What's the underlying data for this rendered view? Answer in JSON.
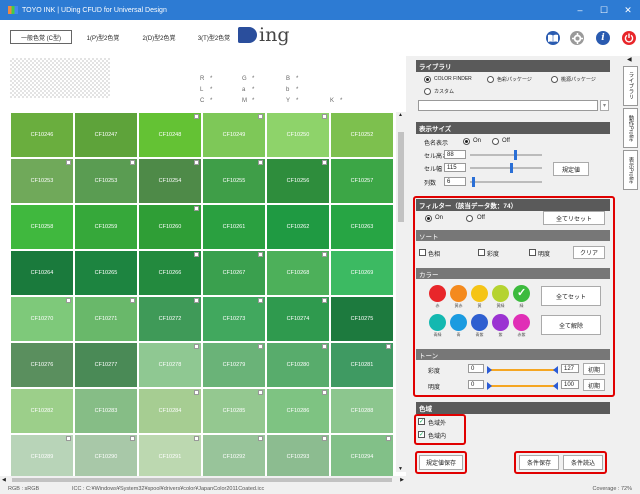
{
  "window": {
    "title": "TOYO INK | UDing CFUD for Universal Design",
    "minimize": "–",
    "maximize": "☐",
    "close": "✕"
  },
  "toolbar": {
    "tabs": [
      "一般色覚 (C型)",
      "1(P)型2色覚",
      "2(D)型2色覚",
      "3(T)型2色覚"
    ],
    "logo_text": "ing",
    "icons": [
      "book-icon",
      "gear-icon",
      "info-icon",
      "power-icon"
    ],
    "info_glyph": "i"
  },
  "swatch_labels": {
    "r": "R",
    "g": "G",
    "b": "B",
    "l": "L",
    "a": "a",
    "b2": "b",
    "c": "C",
    "m": "M",
    "y": "Y",
    "k": "K",
    "sep": "*"
  },
  "grid": {
    "cells": [
      {
        "code": "CF10246",
        "color": "#6aae3e",
        "marked": false
      },
      {
        "code": "CF10247",
        "color": "#5ea33a",
        "marked": false
      },
      {
        "code": "CF10248",
        "color": "#64c234",
        "marked": true
      },
      {
        "code": "CF10249",
        "color": "#7ec858",
        "marked": true
      },
      {
        "code": "CF10250",
        "color": "#8ed36a",
        "marked": true
      },
      {
        "code": "CF10252",
        "color": "#7dc04e",
        "marked": false
      },
      {
        "code": "CF10253",
        "color": "#70a95a",
        "marked": true
      },
      {
        "code": "CF10253",
        "color": "#5a9c52",
        "marked": true
      },
      {
        "code": "CF10254",
        "color": "#4e8a48",
        "marked": true
      },
      {
        "code": "CF10255",
        "color": "#3f9e48",
        "marked": true
      },
      {
        "code": "CF10256",
        "color": "#2e8d3c",
        "marked": true
      },
      {
        "code": "CF10257",
        "color": "#3ca646",
        "marked": false
      },
      {
        "code": "CF10258",
        "color": "#40b83e",
        "marked": false
      },
      {
        "code": "CF10259",
        "color": "#36a83a",
        "marked": false
      },
      {
        "code": "CF10260",
        "color": "#2f9e36",
        "marked": true
      },
      {
        "code": "CF10261",
        "color": "#2aa040",
        "marked": false
      },
      {
        "code": "CF10262",
        "color": "#1f9a42",
        "marked": false
      },
      {
        "code": "CF10263",
        "color": "#27a544",
        "marked": false
      },
      {
        "code": "CF10264",
        "color": "#1a7a3c",
        "marked": false
      },
      {
        "code": "CF10265",
        "color": "#1d8440",
        "marked": false
      },
      {
        "code": "CF10266",
        "color": "#238a3e",
        "marked": true
      },
      {
        "code": "CF10267",
        "color": "#3aa04e",
        "marked": true
      },
      {
        "code": "CF10268",
        "color": "#4db05a",
        "marked": true
      },
      {
        "code": "CF10269",
        "color": "#3cba62",
        "marked": false
      },
      {
        "code": "CF10270",
        "color": "#7ec97a",
        "marked": true
      },
      {
        "code": "CF10271",
        "color": "#69b86a",
        "marked": true
      },
      {
        "code": "CF10272",
        "color": "#3f9a58",
        "marked": true
      },
      {
        "code": "CF10273",
        "color": "#41a85e",
        "marked": true
      },
      {
        "code": "CF10274",
        "color": "#2f9a4e",
        "marked": true
      },
      {
        "code": "CF10275",
        "color": "#1d7a3e",
        "marked": false
      },
      {
        "code": "CF10276",
        "color": "#5a8f5e",
        "marked": false
      },
      {
        "code": "CF10277",
        "color": "#4a8a56",
        "marked": false
      },
      {
        "code": "CF10278",
        "color": "#8fc892",
        "marked": true
      },
      {
        "code": "CF10279",
        "color": "#6ab378",
        "marked": true
      },
      {
        "code": "CF10280",
        "color": "#58ac6c",
        "marked": true
      },
      {
        "code": "CF10281",
        "color": "#3f9a62",
        "marked": true
      },
      {
        "code": "CF10282",
        "color": "#9ccf8a",
        "marked": false
      },
      {
        "code": "CF10283",
        "color": "#86bd86",
        "marked": false
      },
      {
        "code": "CF10284",
        "color": "#a6cd92",
        "marked": true
      },
      {
        "code": "CF10285",
        "color": "#94c890",
        "marked": true
      },
      {
        "code": "CF10286",
        "color": "#7ec382",
        "marked": true
      },
      {
        "code": "CF10288",
        "color": "#8cc68e",
        "marked": false
      },
      {
        "code": "CF10289",
        "color": "#b8d4b8",
        "marked": true
      },
      {
        "code": "CF10290",
        "color": "#a8c8a8",
        "marked": true
      },
      {
        "code": "CF10291",
        "color": "#bcd8b0",
        "marked": true
      },
      {
        "code": "CF10292",
        "color": "#98c49a",
        "marked": true
      },
      {
        "code": "CF10293",
        "color": "#8cbc90",
        "marked": true
      },
      {
        "code": "CF10294",
        "color": "#82c088",
        "marked": true
      }
    ]
  },
  "panel": {
    "library": {
      "title": "ライブラリ",
      "opt1": "COLOR FINDER",
      "opt2": "色彩パッケージ",
      "opt3": "桃源パッケージ",
      "opt4": "カスタム"
    },
    "display": {
      "title": "表示サイズ",
      "name_label": "色名表示",
      "on": "On",
      "off": "Off",
      "cell_h_label": "セル高さ",
      "cell_h": "88",
      "cell_w_label": "セル幅",
      "cell_w": "115",
      "cols_label": "列数",
      "cols": "6",
      "default_button": "規定値"
    },
    "filter": {
      "title": "フィルター（該当データ数：74）",
      "on": "On",
      "off": "Off",
      "reset_button": "全てリセット"
    },
    "sort": {
      "title": "ソート",
      "hue": "色相",
      "chroma": "彩度",
      "lightness": "明度",
      "clear_button": "クリア"
    },
    "color": {
      "title": "カラー",
      "row1": [
        {
          "label": "赤",
          "color": "#e8262a"
        },
        {
          "label": "黄赤",
          "color": "#f48a1e"
        },
        {
          "label": "黄",
          "color": "#f5c416"
        },
        {
          "label": "黄緑",
          "color": "#b5d330"
        },
        {
          "label": "緑",
          "color": "#3dbb3e"
        }
      ],
      "row2": [
        {
          "label": "青緑",
          "color": "#14b8b0"
        },
        {
          "label": "青",
          "color": "#1b9be0"
        },
        {
          "label": "青紫",
          "color": "#2f5fd0"
        },
        {
          "label": "紫",
          "color": "#9b33d2"
        },
        {
          "label": "赤紫",
          "color": "#e02fb6"
        }
      ],
      "set_all_button": "全てセット",
      "clear_all_button": "全て解除"
    },
    "tone": {
      "title": "トーン",
      "chroma_label": "彩度",
      "chroma_min": "0",
      "chroma_max": "127",
      "chroma_reset": "初期",
      "light_label": "明度",
      "light_min": "0",
      "light_max": "100",
      "light_reset": "初期"
    },
    "gamut": {
      "title": "色域",
      "outside": "色域外",
      "inside": "色域内"
    },
    "bottom": {
      "save_default": "規定値保存",
      "save_cond": "条件保存",
      "load_cond": "条件読込"
    },
    "sidetabs": [
      "ライブラリ",
      "動作Profile",
      "表示Profile"
    ],
    "check_mark": "✓",
    "collapse_arrow": "◀",
    "dropdown_arrow": "▾"
  },
  "scrollbar": {
    "up": "▲",
    "down": "▼",
    "left": "◀",
    "right": "▶"
  },
  "status": {
    "rgb": "RGB : sRGB",
    "icc": "ICC : C:¥Windows¥System32¥spool¥drivers¥color¥JapanColor2011Coated.icc",
    "coverage": "Coverage : 72%"
  },
  "colors": {
    "titlebar": "#2d7bd3",
    "highlight": "#e00000"
  }
}
